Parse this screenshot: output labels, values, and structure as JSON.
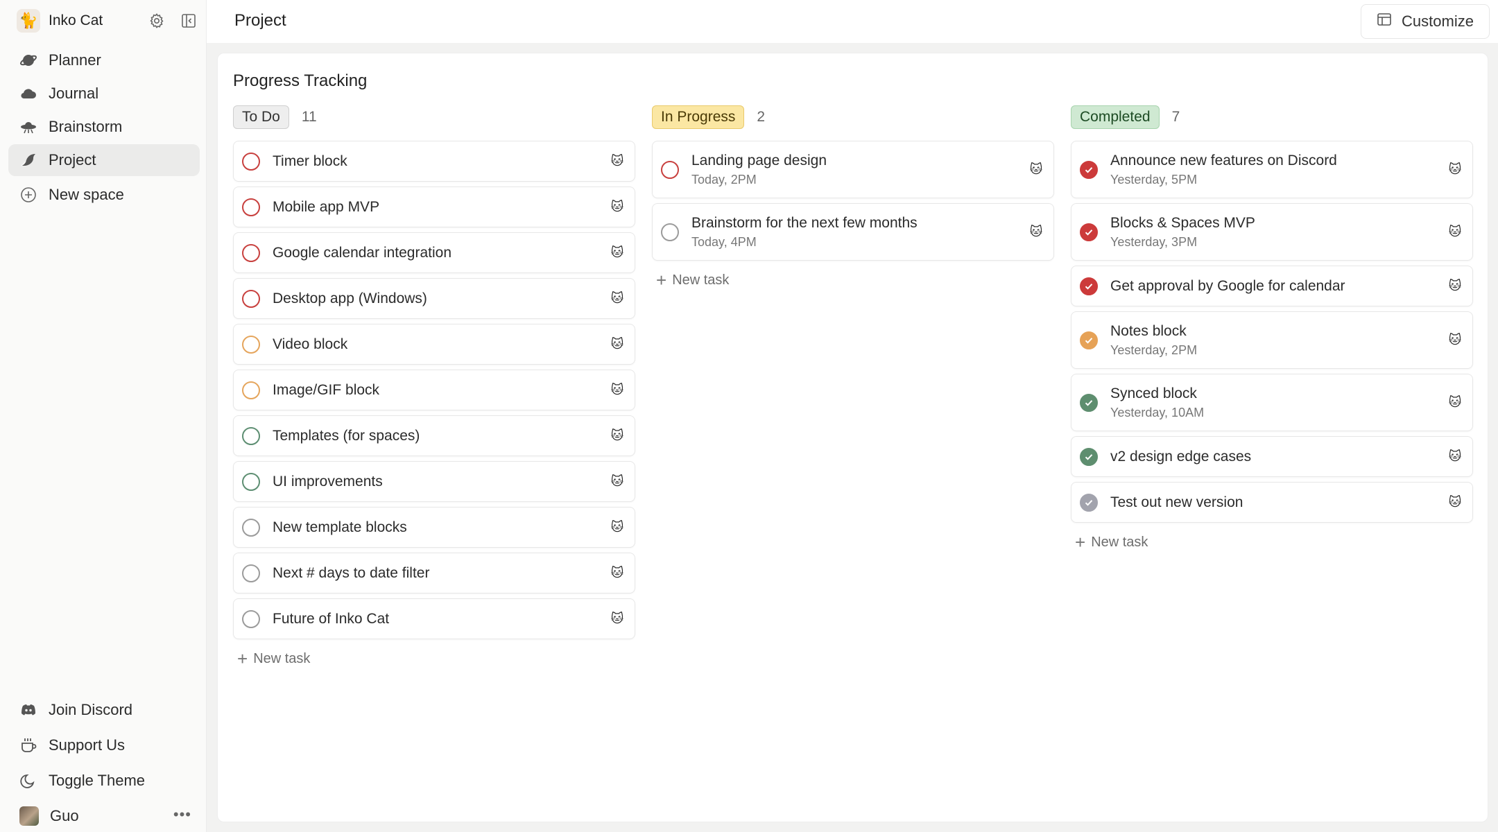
{
  "workspace": {
    "name": "Inko Cat",
    "avatar": "🐈"
  },
  "sidebar": {
    "items": [
      {
        "label": "Planner",
        "icon": "planet-icon",
        "active": false
      },
      {
        "label": "Journal",
        "icon": "cloud-icon",
        "active": false
      },
      {
        "label": "Brainstorm",
        "icon": "ufo-icon",
        "active": false
      },
      {
        "label": "Project",
        "icon": "bird-icon",
        "active": true
      }
    ],
    "new_space": "New space",
    "bottom": [
      {
        "label": "Join Discord",
        "icon": "discord-icon"
      },
      {
        "label": "Support Us",
        "icon": "coffee-icon"
      },
      {
        "label": "Toggle Theme",
        "icon": "moon-icon"
      }
    ],
    "user": {
      "name": "Guo"
    }
  },
  "header": {
    "title": "Project",
    "customize_label": "Customize"
  },
  "board": {
    "title": "Progress Tracking",
    "columns": [
      {
        "label": "To Do",
        "count": "11",
        "new_task": "New task",
        "tasks": [
          {
            "title": "Timer block"
          },
          {
            "title": "Mobile app MVP"
          },
          {
            "title": "Google calendar integration"
          },
          {
            "title": "Desktop app (Windows)"
          },
          {
            "title": "Video block"
          },
          {
            "title": "Image/GIF block"
          },
          {
            "title": "Templates (for spaces)"
          },
          {
            "title": "UI improvements"
          },
          {
            "title": "New template blocks"
          },
          {
            "title": "Next # days to date filter"
          },
          {
            "title": "Future of Inko Cat"
          }
        ]
      },
      {
        "label": "In Progress",
        "count": "2",
        "new_task": "New task",
        "tasks": [
          {
            "title": "Landing page design",
            "date": "Today, 2PM"
          },
          {
            "title": "Brainstorm for the next few months",
            "date": "Today, 4PM"
          }
        ]
      },
      {
        "label": "Completed",
        "count": "7",
        "new_task": "New task",
        "tasks": [
          {
            "title": "Announce new features on Discord",
            "date": "Yesterday, 5PM"
          },
          {
            "title": "Blocks & Spaces MVP",
            "date": "Yesterday, 3PM"
          },
          {
            "title": "Get approval by Google for calendar"
          },
          {
            "title": "Notes block",
            "date": "Yesterday, 2PM"
          },
          {
            "title": "Synced block",
            "date": "Yesterday, 10AM"
          },
          {
            "title": "v2 design edge cases"
          },
          {
            "title": "Test out new version"
          }
        ]
      }
    ]
  },
  "colors": {
    "red": "#cc3a3a",
    "orange": "#e6a257",
    "green": "#5e8e6f",
    "gray": "#a2a3ad"
  }
}
